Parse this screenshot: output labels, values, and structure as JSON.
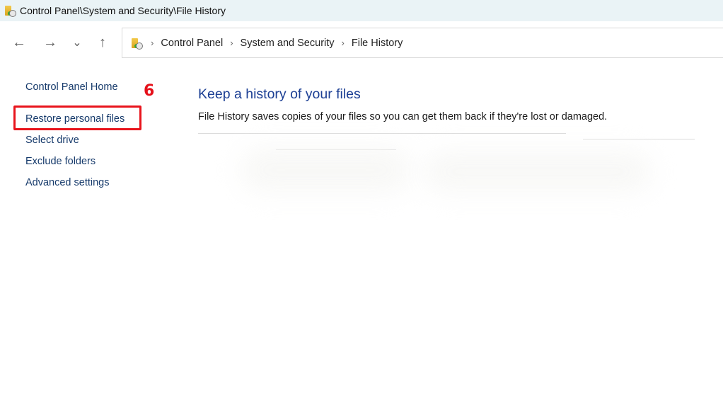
{
  "window": {
    "title": "Control Panel\\System and Security\\File History",
    "icon": "file-history-folder-icon"
  },
  "navigation": {
    "back_icon": "←",
    "forward_icon": "→",
    "recent_icon": "⌄",
    "up_icon": "↑"
  },
  "address_bar": {
    "icon": "file-history-folder-icon",
    "separator": "›",
    "crumbs": [
      "Control Panel",
      "System and Security",
      "File History"
    ]
  },
  "sidebar": {
    "items": [
      {
        "label": "Control Panel Home"
      },
      {
        "label": "Restore personal files",
        "highlighted": true
      },
      {
        "label": "Select drive"
      },
      {
        "label": "Exclude folders"
      },
      {
        "label": "Advanced settings"
      }
    ]
  },
  "annotation": {
    "step_number": "6",
    "highlight_color": "#e8141c"
  },
  "main": {
    "heading": "Keep a history of your files",
    "description": "File History saves copies of your files so you can get them back if they're lost or damaged."
  },
  "colors": {
    "link": "#163a6b",
    "heading": "#1c3f94",
    "titlebar_bg": "#eaf3f6"
  }
}
